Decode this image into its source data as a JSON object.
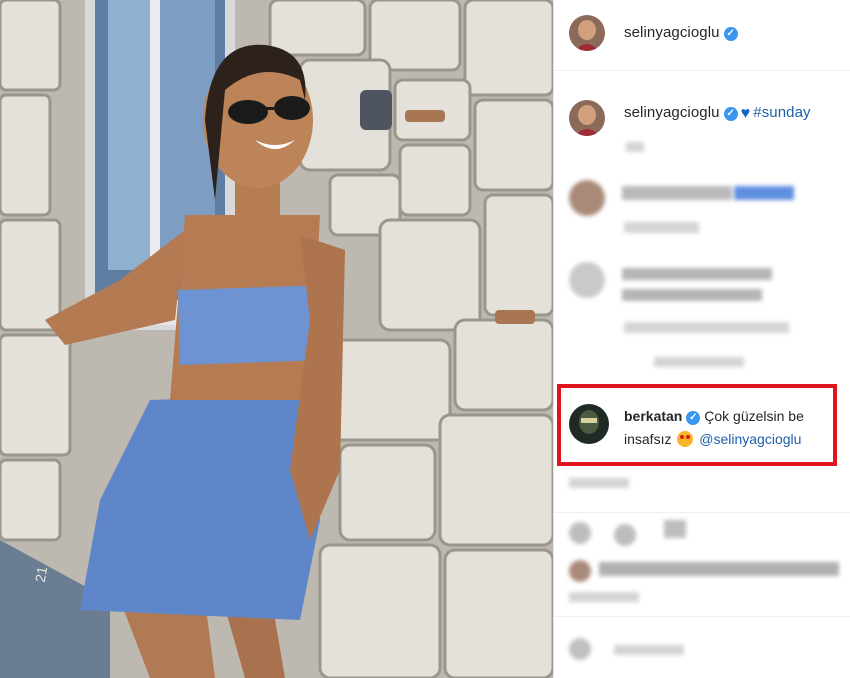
{
  "post": {
    "author": "selinyagcioglu",
    "verified": true,
    "caption_emoji": "heart-icon",
    "caption_hashtag": "#sunday",
    "photo_date_stamp": "21"
  },
  "highlighted_comment": {
    "username": "berkatan",
    "verified": true,
    "text_line1": "Çok güzelsin be",
    "text_line2": "insafsız",
    "emoji": "star-struck-emoji",
    "mention": "@selinyagcioglu"
  },
  "colors": {
    "highlight_border": "#e0141c",
    "verified_badge": "#3897f0",
    "link": "#1d5fa8"
  },
  "icons": [
    "verified-badge-icon",
    "heart-icon",
    "like-icon",
    "comment-icon",
    "share-icon",
    "bookmark-icon",
    "emoji-icon"
  ]
}
